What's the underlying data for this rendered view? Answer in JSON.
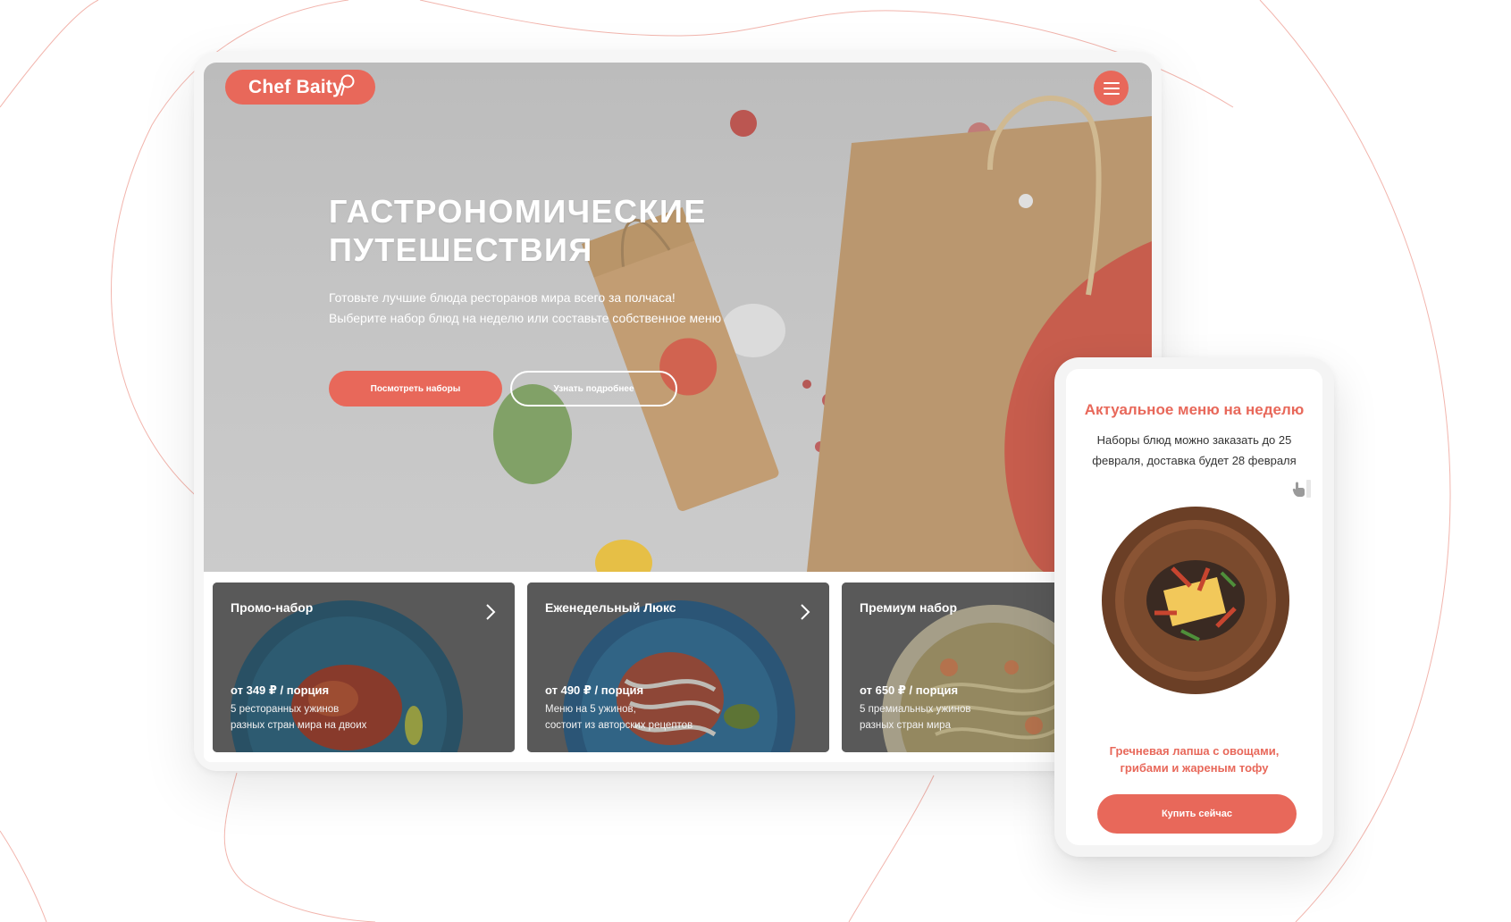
{
  "brand": {
    "logo_text": "Chef Baity",
    "accent_color": "#e8685a"
  },
  "header": {
    "menu_icon": "hamburger-icon"
  },
  "hero": {
    "title_line1": "ГАСТРОНОМИЧЕСКИЕ",
    "title_line2": "ПУТЕШЕСТВИЯ",
    "subtitle_line1": "Готовьте лучшие блюда ресторанов мира всего за полчаса!",
    "subtitle_line2": "Выберите набор блюд на неделю или составьте собственное меню",
    "primary_button": "Посмотреть наборы",
    "secondary_button": "Узнать подробнее"
  },
  "cards": [
    {
      "title": "Промо-набор",
      "price": "от 349 ₽ / порция",
      "desc_line1": "5 ресторанных ужинов",
      "desc_line2": "разных стран мира на двоих",
      "arrow_icon": "chevron-right-icon"
    },
    {
      "title": "Еженедельный Люкс",
      "price": "от 490 ₽ / порция",
      "desc_line1": "Меню на 5 ужинов,",
      "desc_line2": "состоит из авторских рецептов",
      "arrow_icon": "chevron-right-icon"
    },
    {
      "title": "Премиум набор",
      "price": "от 650 ₽ / порция",
      "desc_line1": "5 премиальных ужинов",
      "desc_line2": "разных стран мира"
    }
  ],
  "mobile": {
    "title": "Актуальное меню на неделю",
    "text_line1": "Наборы блюд можно заказать до 25",
    "text_line2": "февраля, доставка будет 28 февраля",
    "dish_line1": "Гречневая лапша с овощами,",
    "dish_line2": "грибами и жареным тофу",
    "buy_button": "Купить сейчас",
    "cursor_icon": "hand-pointer-icon"
  }
}
